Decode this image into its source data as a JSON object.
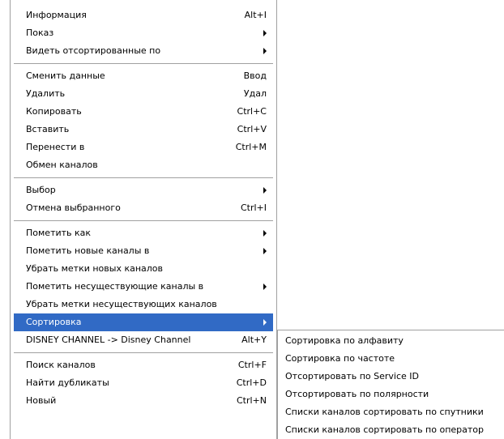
{
  "context_menu": {
    "groups": [
      [
        {
          "label": "Информация",
          "shortcut": "Alt+I",
          "submenu": false
        },
        {
          "label": "Показ",
          "shortcut": "",
          "submenu": true
        },
        {
          "label": "Видеть отсортированные по",
          "shortcut": "",
          "submenu": true
        }
      ],
      [
        {
          "label": "Сменить данные",
          "shortcut": "Ввод",
          "submenu": false
        },
        {
          "label": "Удалить",
          "shortcut": "Удал",
          "submenu": false
        },
        {
          "label": "Копировать",
          "shortcut": "Ctrl+C",
          "submenu": false
        },
        {
          "label": "Вставить",
          "shortcut": "Ctrl+V",
          "submenu": false
        },
        {
          "label": "Перенести в",
          "shortcut": "Ctrl+M",
          "submenu": false
        },
        {
          "label": "Обмен каналов",
          "shortcut": "",
          "submenu": false
        }
      ],
      [
        {
          "label": "Выбор",
          "shortcut": "",
          "submenu": true
        },
        {
          "label": "Отмена выбранного",
          "shortcut": "Ctrl+I",
          "submenu": false
        }
      ],
      [
        {
          "label": "Пометить как",
          "shortcut": "",
          "submenu": true
        },
        {
          "label": "Пометить новые каналы в",
          "shortcut": "",
          "submenu": true
        },
        {
          "label": "Убрать метки новых каналов",
          "shortcut": "",
          "submenu": false
        },
        {
          "label": "Пометить несуществующие каналы в",
          "shortcut": "",
          "submenu": true
        },
        {
          "label": "Убрать метки несуществующих каналов",
          "shortcut": "",
          "submenu": false
        },
        {
          "label": "Сортировка",
          "shortcut": "",
          "submenu": true,
          "selected": true
        },
        {
          "label": "DISNEY CHANNEL -> Disney Channel",
          "shortcut": "Alt+Y",
          "submenu": false
        }
      ],
      [
        {
          "label": "Поиск каналов",
          "shortcut": "Ctrl+F",
          "submenu": false
        },
        {
          "label": "Найти дубликаты",
          "shortcut": "Ctrl+D",
          "submenu": false
        },
        {
          "label": "Новый",
          "shortcut": "Ctrl+N",
          "submenu": false
        }
      ]
    ]
  },
  "sort_submenu": {
    "items": [
      "Сортировка по алфавиту",
      "Сортировка по частоте",
      "Отсортировать по Service ID",
      "Отсортировать по полярности",
      "Списки каналов сортировать по спутники",
      "Списки каналов сортировать по оператор"
    ]
  },
  "colors": {
    "selection": "#316ac5",
    "separator": "#a0a0a0"
  }
}
